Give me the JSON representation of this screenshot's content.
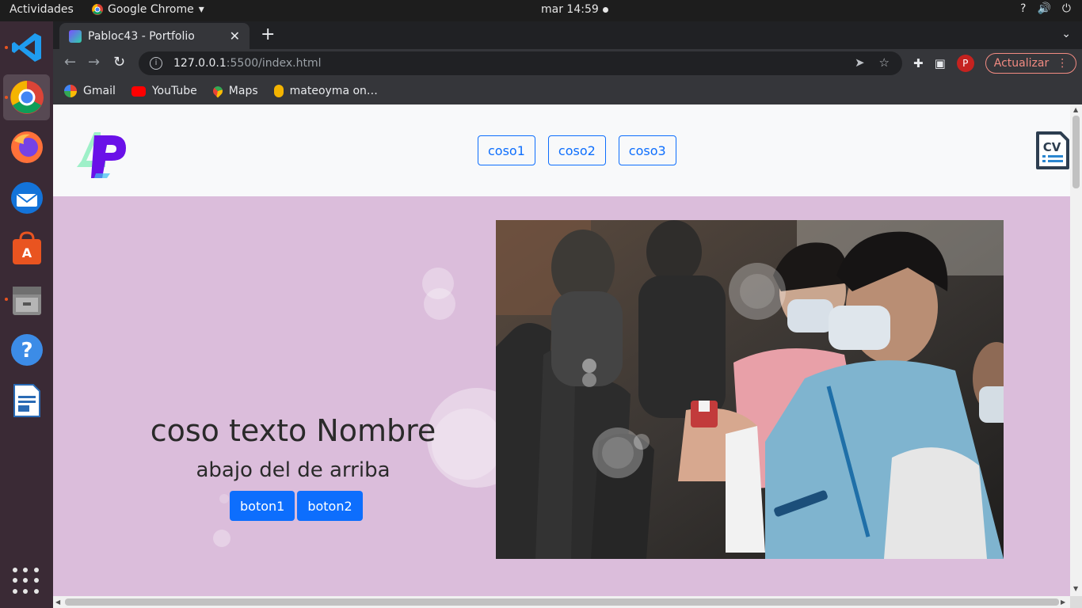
{
  "topbar": {
    "activities": "Actividades",
    "app_name": "Google Chrome",
    "clock": "mar 14:59",
    "help": "?",
    "volume": "🔊",
    "power": "⏻"
  },
  "dock": {
    "apps": [
      "vscode-icon",
      "chrome-icon",
      "firefox-icon",
      "thunderbird-icon",
      "software-icon",
      "files-icon",
      "help-icon",
      "writer-icon"
    ]
  },
  "browser": {
    "tab_title": "Pabloc43 - Portfolio",
    "url_host": "127.0.0.1",
    "url_path": ":5500/index.html",
    "update_label": "Actualizar",
    "avatar_letter": "P",
    "bookmarks": [
      "Gmail",
      "YouTube",
      "Maps",
      "mateoyma on…"
    ],
    "bookmark_colors": [
      "#ea4335",
      "#ff0000",
      "#34a853",
      "#f4b400"
    ]
  },
  "page": {
    "nav": [
      "coso1",
      "coso2",
      "coso3"
    ],
    "cv_label": "CV",
    "hero_title": "coso texto Nombre",
    "hero_subtitle": "abajo del de arriba",
    "buttons": [
      "boton1",
      "boton2"
    ]
  },
  "colors": {
    "hero_bg": "#dbbddb",
    "primary": "#0d6efd",
    "header_bg": "#f8f9fa"
  }
}
